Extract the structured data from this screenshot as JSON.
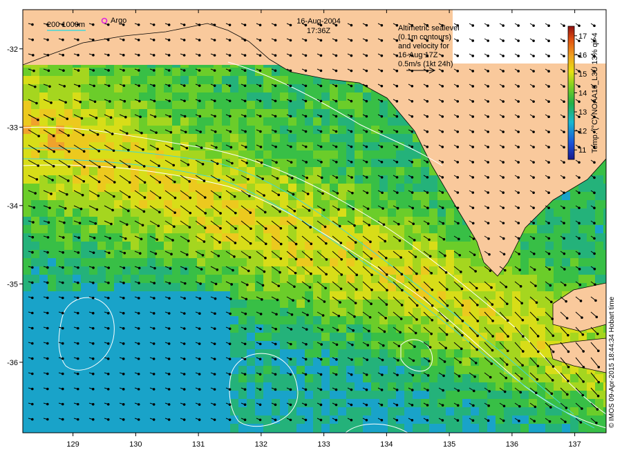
{
  "map": {
    "title_date": "16-Aug-2004",
    "title_time": "17:36Z",
    "lat_ticks": [
      "-32",
      "-33",
      "-34",
      "-35",
      "-36"
    ],
    "lon_ticks": [
      "129",
      "130",
      "131",
      "132",
      "133",
      "134",
      "135",
      "136",
      "137"
    ],
    "lon_range": [
      128.2,
      137.5
    ],
    "lat_range": [
      -36.9,
      -31.5
    ]
  },
  "legend": {
    "isobaths": "200  1000m",
    "argo": "Argo"
  },
  "annotation": {
    "line1": "Altimetric sealevel",
    "line2": "(0.1m contours)",
    "line3": "and velocity for",
    "line4": "16-Aug 17Z",
    "line5": "0.5m/s (1kt 24h)"
  },
  "colorbar": {
    "label": "Temp. (°C) NOAA16_L3U 13% qi>4",
    "ticks": [
      "17",
      "16",
      "15",
      "14",
      "13",
      "12",
      "11"
    ],
    "range": [
      10.5,
      17.5
    ]
  },
  "credit": "© IMOS 09-Apr-2015 18:44:34 Hobart time",
  "colors": {
    "land": "#f9c99c",
    "sst_warm": "#f0a030",
    "sst_mid": "#b8d818",
    "sst_cool": "#2ab060",
    "sst_cold": "#1aa0c8",
    "isobath": "#40d8d8",
    "contour": "#ffffff"
  }
}
